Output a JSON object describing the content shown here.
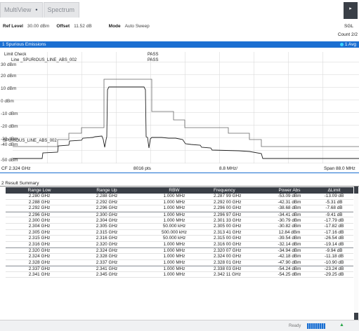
{
  "tabs": [
    {
      "label": "MultiView",
      "star": "•"
    },
    {
      "label": "Spectrum"
    }
  ],
  "header": {
    "ref_level_key": "Ref Level",
    "ref_level_val": "30.00 dBm",
    "offset_key": "Offset",
    "offset_val": "11.52 dB",
    "mode_key": "Mode",
    "mode_val": "Auto Sweep",
    "sgl": "SGL",
    "count": "Count 2/2",
    "sgl_button": "▸"
  },
  "window1": {
    "title": "1 Spurious Emissions",
    "avg": "1 Avg",
    "limit_check_label": "Limit Check",
    "limit_check_result": "PASS",
    "limit_line_label": "Line _SPURIOUS_LINE_ABS_002",
    "limit_line_result": "PASS",
    "trace_label": "SPURIOUS_LINE_ABS_002",
    "y_ticks": [
      "30 dBm",
      "20 dBm",
      "10 dBm",
      "0 dBm",
      "-10 dBm",
      "-20 dBm",
      "-30 dBm",
      "-40 dBm",
      "-50 dBm"
    ],
    "cf": "CF 2.324 GHz",
    "pts": "8016 pts",
    "div": "8.8 MHz/",
    "span": "Span 88.0 MHz"
  },
  "window2": {
    "title": "2 Result Summary",
    "columns": [
      "Range Low",
      "Range Up",
      "RBW",
      "Frequency",
      "Power Abs",
      "ΔLimit"
    ],
    "rows": [
      [
        "2.280 GHz",
        "2.288 GHz",
        "1.000 MHz",
        "2.287 99 GHz",
        "-53.09 dBm",
        "-13.09 dB"
      ],
      [
        "2.288 GHz",
        "2.292 GHz",
        "1.000 MHz",
        "2.292 00 GHz",
        "-42.31 dBm",
        "-5.31 dB"
      ],
      [
        "2.292 GHz",
        "2.296 GHz",
        "1.000 MHz",
        "2.296 00 GHz",
        "-38.68 dBm",
        "-7.68 dB"
      ],
      [
        "2.296 GHz",
        "2.300 GHz",
        "1.000 MHz",
        "2.296 97 GHz",
        "-34.41 dBm",
        "-9.41 dB"
      ],
      [
        "2.300 GHz",
        "2.304 GHz",
        "1.000 MHz",
        "2.301 33 GHz",
        "-30.79 dBm",
        "-17.79 dB"
      ],
      [
        "2.304 GHz",
        "2.305 GHz",
        "50.000 kHz",
        "2.305 00 GHz",
        "-30.82 dBm",
        "-17.82 dB"
      ],
      [
        "2.305 GHz",
        "2.315 GHz",
        "500.000 kHz",
        "2.313 41 GHz",
        "12.84 dBm",
        "-17.16 dB"
      ],
      [
        "2.315 GHz",
        "2.316 GHz",
        "50.000 kHz",
        "2.315 00 GHz",
        "-39.54 dBm",
        "-26.54 dB"
      ],
      [
        "2.316 GHz",
        "2.320 GHz",
        "1.000 MHz",
        "2.316 00 GHz",
        "-32.14 dBm",
        "-19.14 dB"
      ],
      [
        "2.320 GHz",
        "2.324 GHz",
        "1.000 MHz",
        "2.320 07 GHz",
        "-34.94 dBm",
        "-9.94 dB"
      ],
      [
        "2.324 GHz",
        "2.328 GHz",
        "1.000 MHz",
        "2.324 00 GHz",
        "-42.18 dBm",
        "-11.18 dB"
      ],
      [
        "2.328 GHz",
        "2.337 GHz",
        "1.000 MHz",
        "2.328 01 GHz",
        "-47.90 dBm",
        "-10.90 dB"
      ],
      [
        "2.337 GHz",
        "2.341 GHz",
        "1.000 MHz",
        "2.338 03 GHz",
        "-54.24 dBm",
        "-23.24 dB"
      ],
      [
        "2.341 GHz",
        "2.345 GHz",
        "1.000 MHz",
        "2.342 11 GHz",
        "-54.25 dBm",
        "-29.25 dB"
      ]
    ],
    "group_starts": [
      3,
      9,
      12
    ]
  },
  "status": {
    "ready": "Ready"
  },
  "colors": {
    "accent": "#1b6fd1",
    "header_dark": "#3a3f47",
    "trace": "#222222",
    "limit_line": "#555555"
  }
}
